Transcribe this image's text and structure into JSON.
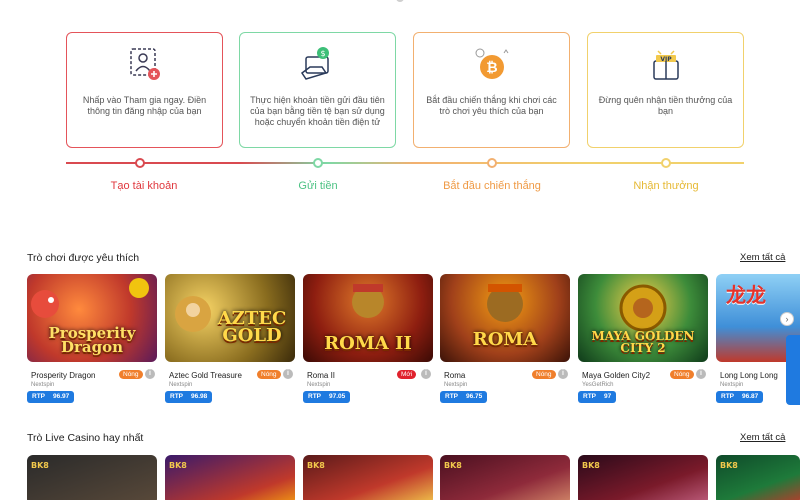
{
  "steps": [
    {
      "desc": "Nhấp vào Tham gia ngay. Điền thông tin đăng nhập của bạn",
      "label": "Tạo tài khoản",
      "color": "#e4545a",
      "icon": "user-add-icon"
    },
    {
      "desc": "Thực hiện khoản tiền gửi đầu tiên của bạn bằng tiền tệ bạn sử dụng hoặc chuyển khoản tiền điện tử",
      "label": "Gửi tiền",
      "color": "#5fcf8e",
      "icon": "deposit-hand-icon"
    },
    {
      "desc": "Bắt đầu chiến thắng khi chơi các trò chơi yêu thích của bạn",
      "label": "Bắt đầu chiến thắng",
      "color": "#f0a050",
      "icon": "bitcoin-icon"
    },
    {
      "desc": "Đừng quên nhận tiền thưởng của bạn",
      "label": "Nhận thưởng",
      "color": "#e9bf3c",
      "icon": "vip-gift-icon"
    }
  ],
  "favorites": {
    "title": "Trò chơi được yêu thích",
    "see_all": "Xem tất cả",
    "games": [
      {
        "name": "Prosperity Dragon",
        "provider": "Nextspin",
        "badge": "Nóng",
        "rtp_label": "RTP",
        "rtp": "96.97",
        "thumb_title": "Prosperity Dragon"
      },
      {
        "name": "Aztec Gold Treasure",
        "provider": "Nextspin",
        "badge": "Nóng",
        "rtp_label": "RTP",
        "rtp": "96.98",
        "thumb_title": "AZTEC GOLD"
      },
      {
        "name": "Roma II",
        "provider": "Nextspin",
        "badge": "Mới",
        "rtp_label": "RTP",
        "rtp": "97.05",
        "thumb_title": "ROMA II"
      },
      {
        "name": "Roma",
        "provider": "Nextspin",
        "badge": "Nóng",
        "rtp_label": "RTP",
        "rtp": "96.75",
        "thumb_title": "ROMA"
      },
      {
        "name": "Maya Golden City2",
        "provider": "YesGetRich",
        "badge": "Nóng",
        "rtp_label": "RTP",
        "rtp": "97",
        "thumb_title": "MAYA GOLDEN CITY 2"
      },
      {
        "name": "Long Long Long",
        "provider": "Nextspin",
        "badge": "",
        "rtp_label": "RTP",
        "rtp": "96.87",
        "thumb_title": "龙龙"
      }
    ]
  },
  "live": {
    "title": "Trò Live Casino hay nhất",
    "see_all": "Xem tất cả",
    "logos": [
      "BK8",
      "BK8",
      "BK8",
      "BK8",
      "BK8",
      "BK8"
    ]
  }
}
